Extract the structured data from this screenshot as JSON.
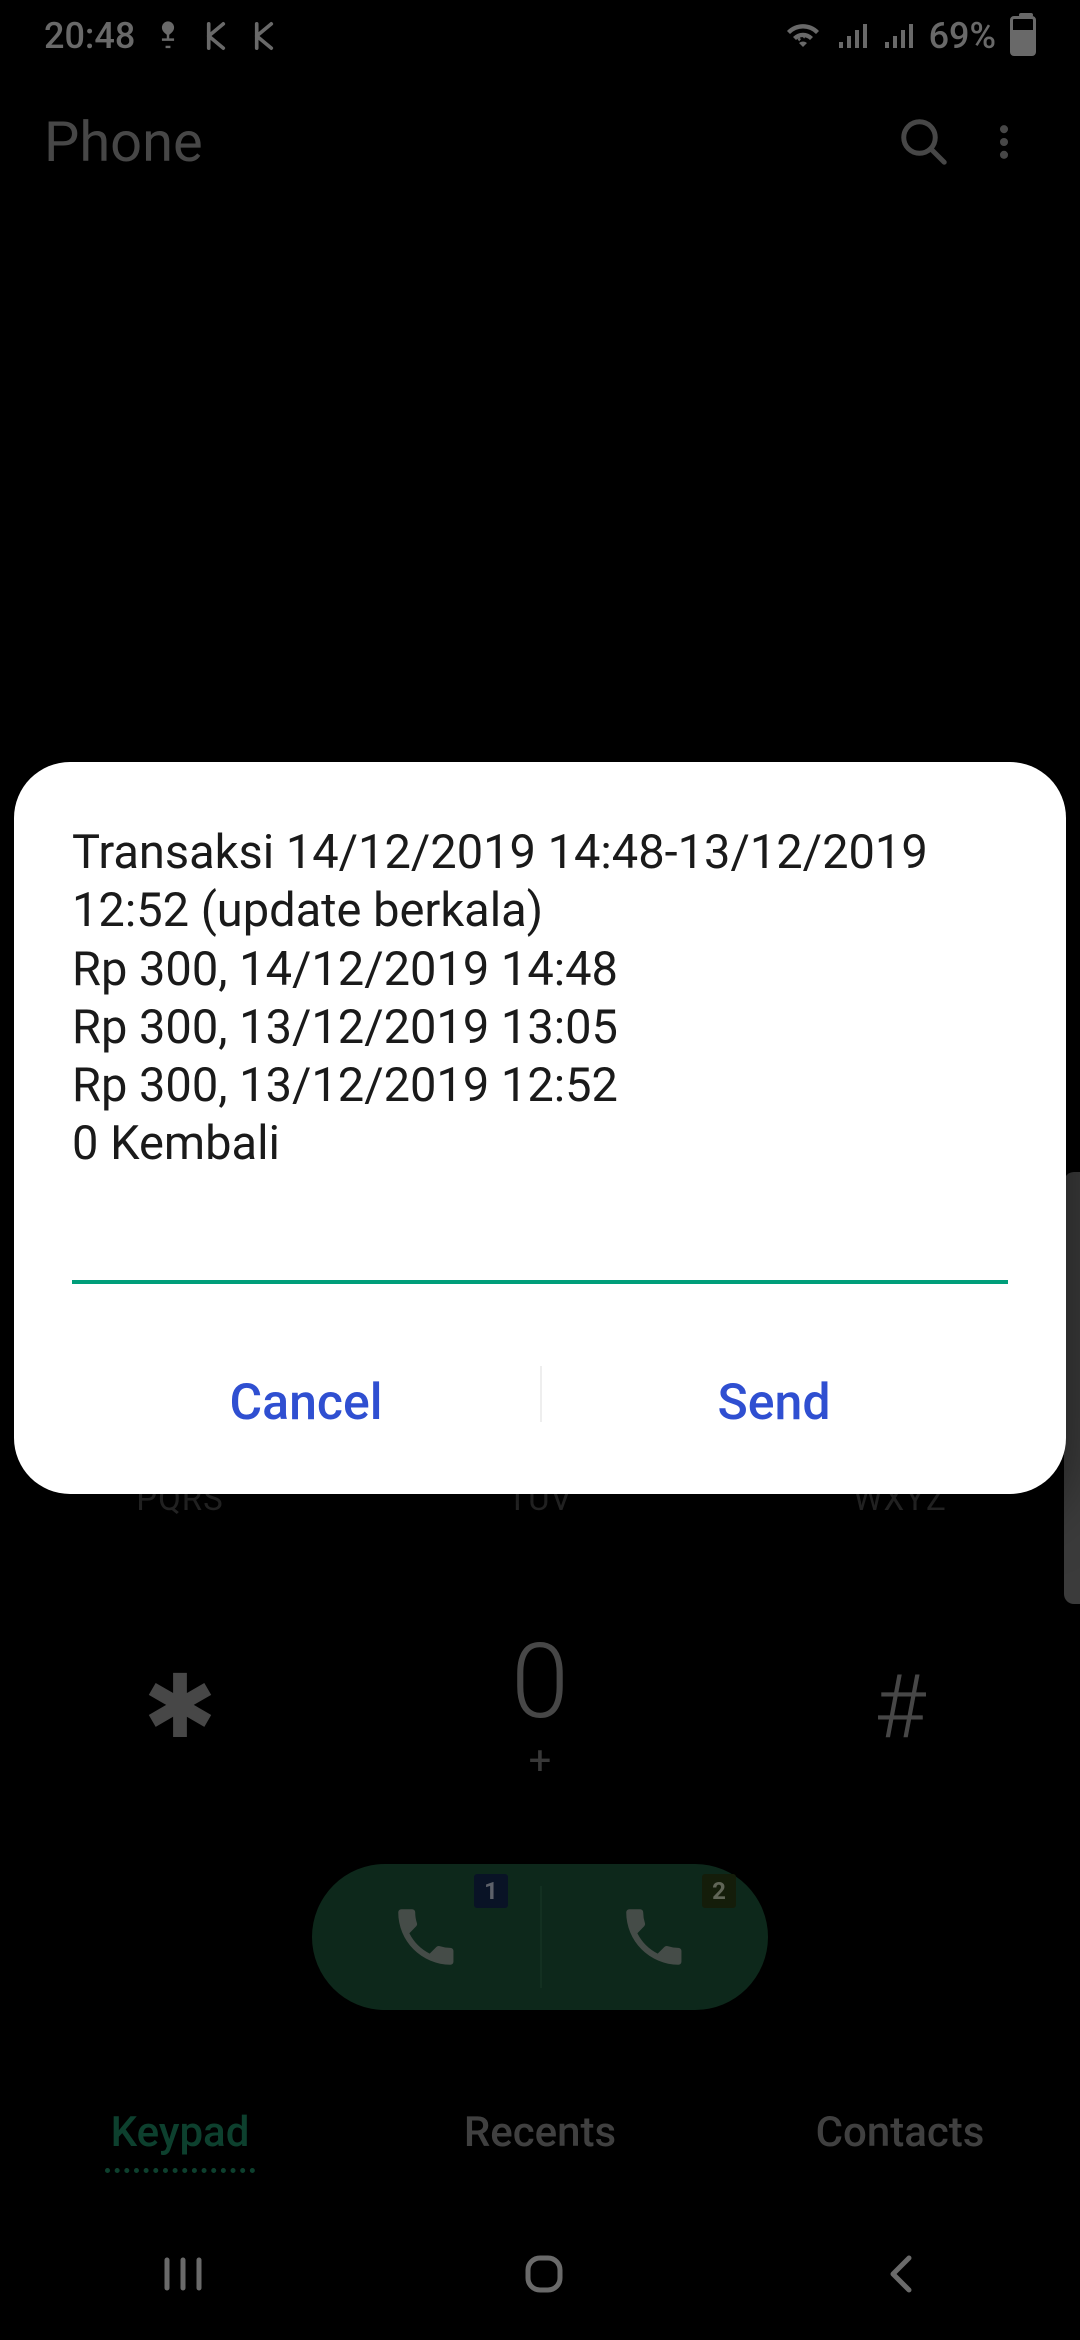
{
  "status": {
    "time": "20:48",
    "battery_pct": "69%"
  },
  "header": {
    "title": "Phone"
  },
  "dialog": {
    "message": "Transaksi 14/12/2019 14:48-13/12/2019 12:52 (update berkala)\nRp 300, 14/12/2019 14:48\nRp 300, 13/12/2019 13:05\nRp 300, 13/12/2019 12:52\n0 Kembali",
    "input_value": "",
    "cancel": "Cancel",
    "send": "Send"
  },
  "keypad": {
    "row_letters": {
      "pqrs": "PQRS",
      "tuv": "TUV",
      "wxyz": "WXYZ"
    },
    "zero": "0",
    "plus": "+",
    "star": "✱",
    "hash": "#",
    "sim1": "1",
    "sim2": "2"
  },
  "tabs": {
    "keypad": "Keypad",
    "recents": "Recents",
    "contacts": "Contacts"
  }
}
